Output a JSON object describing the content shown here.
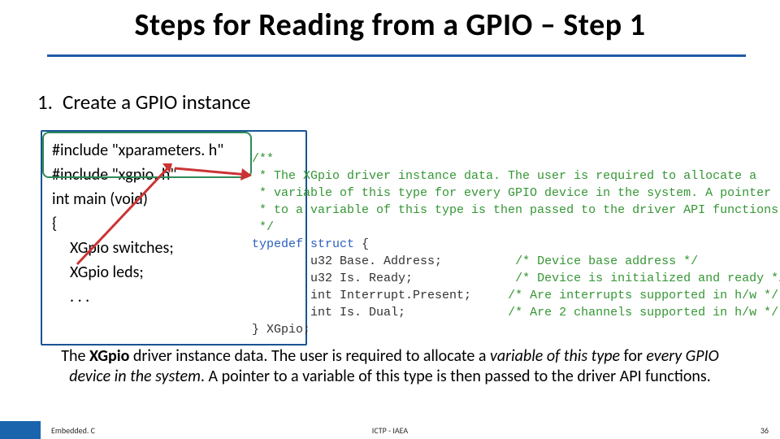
{
  "title": {
    "prefix": "Steps for Reading from a GPIO – ",
    "suffix": "Step 1"
  },
  "step": {
    "number": "1.",
    "text": "Create a GPIO instance"
  },
  "code": {
    "line1": "#include \"xparameters. h\"",
    "line2": "#include \"xgpio. h\"",
    "line3": "int main (void)",
    "line4": "{",
    "line5": "XGpio switches;",
    "line6": "XGpio leds;",
    "line7": ". . ."
  },
  "struct": {
    "c1": "/**",
    "c2": " * The XGpio driver instance data. The user is required to allocate a",
    "c3": " * variable of this type for every GPIO device in the system. A pointer",
    "c4": " * to a variable of this type is then passed to the driver API functions.",
    "c5": " */",
    "kw_typedef": "typedef ",
    "kw_struct": "struct ",
    "open": "{",
    "f1_type": "        u32 ",
    "f1_name": "Base. Address;",
    "f1_comment": "          /* Device base address */",
    "f2_type": "        u32 ",
    "f2_name": "Is. Ready;",
    "f2_comment": "              /* Device is initialized and ready */",
    "f3_type": "        int ",
    "f3_name": "Interrupt.Present;",
    "f3_comment": "     /* Are interrupts supported in h/w */",
    "f4_type": "        int ",
    "f4_name": "Is. Dual;",
    "f4_comment": "              /* Are 2 channels supported in h/w */",
    "close": "} XGpio;"
  },
  "summary": {
    "p1": "The ",
    "bold1": "XGpio",
    "p2": " driver instance data. The user is required to allocate a ",
    "it1": "variable of this type",
    "p3": " for ",
    "it2": "every GPIO device in the system",
    "p4": ". A pointer to a variable of this type is then passed to the driver API functions."
  },
  "footer": {
    "left": "Embedded. C",
    "center": "ICTP - IAEA",
    "page": "36"
  }
}
